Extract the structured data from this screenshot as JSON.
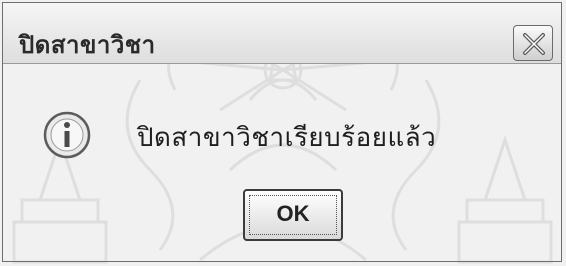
{
  "dialog": {
    "title": "ปิดสาขาวิชา",
    "message": "ปิดสาขาวิชาเรียบร้อยแล้ว",
    "ok_label": "OK"
  },
  "icons": {
    "info": "info-icon",
    "close": "close-icon"
  },
  "colors": {
    "background": "#f1f1f1",
    "border": "#6e6e6e"
  }
}
